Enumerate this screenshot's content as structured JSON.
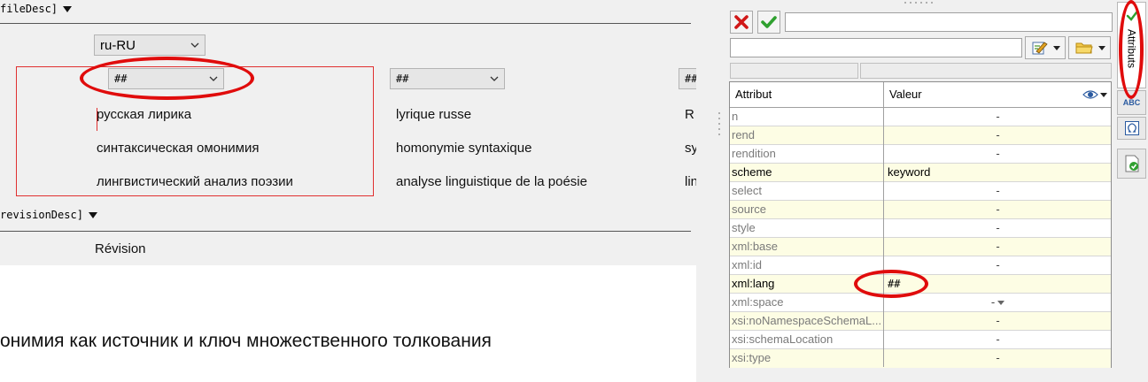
{
  "editor": {
    "file_desc_tag": "fileDesc]",
    "revision_desc_tag": "revisionDesc]",
    "lang_combo": "ru-RU",
    "keyword_combos": [
      "##",
      "##",
      "##"
    ],
    "keywords_ru": [
      "русская лирика",
      "синтаксическая омонимия",
      "лингвистический анализ поэзии"
    ],
    "keywords_fr": [
      "lyrique russe",
      "homonymie syntaxique",
      "analyse linguistique de la poésie"
    ],
    "keywords_third": [
      "R",
      "sy",
      "lin"
    ],
    "revision_label": "Révision",
    "heading_text": "онимия как источник и ключ множественного толкования"
  },
  "panel": {
    "columns": {
      "attribute": "Attribut",
      "value": "Valeur"
    },
    "side_tab_label": "Attributs",
    "abc_label": "ABC",
    "attributes": [
      {
        "name": "n",
        "value": "-",
        "set": false
      },
      {
        "name": "rend",
        "value": "-",
        "set": false
      },
      {
        "name": "rendition",
        "value": "-",
        "set": false
      },
      {
        "name": "scheme",
        "value": "keyword",
        "set": true
      },
      {
        "name": "select",
        "value": "-",
        "set": false
      },
      {
        "name": "source",
        "value": "-",
        "set": false
      },
      {
        "name": "style",
        "value": "-",
        "set": false
      },
      {
        "name": "xml:base",
        "value": "-",
        "set": false
      },
      {
        "name": "xml:id",
        "value": "-",
        "set": false
      },
      {
        "name": "xml:lang",
        "value": "##",
        "set": true
      },
      {
        "name": "xml:space",
        "value": "-",
        "set": false
      },
      {
        "name": "xsi:noNamespaceSchemaL...",
        "value": "-",
        "set": false
      },
      {
        "name": "xsi:schemaLocation",
        "value": "-",
        "set": false
      },
      {
        "name": "xsi:type",
        "value": "-",
        "set": false
      }
    ]
  },
  "colors": {
    "highlight_oval": "#e00c0c",
    "selection_box": "#e03030",
    "row_highlight": "#fdfde4"
  },
  "icons": [
    "red-x-icon",
    "green-check-icon",
    "edit-icon",
    "folder-icon",
    "eye-icon",
    "omega-icon",
    "validate-icon"
  ]
}
